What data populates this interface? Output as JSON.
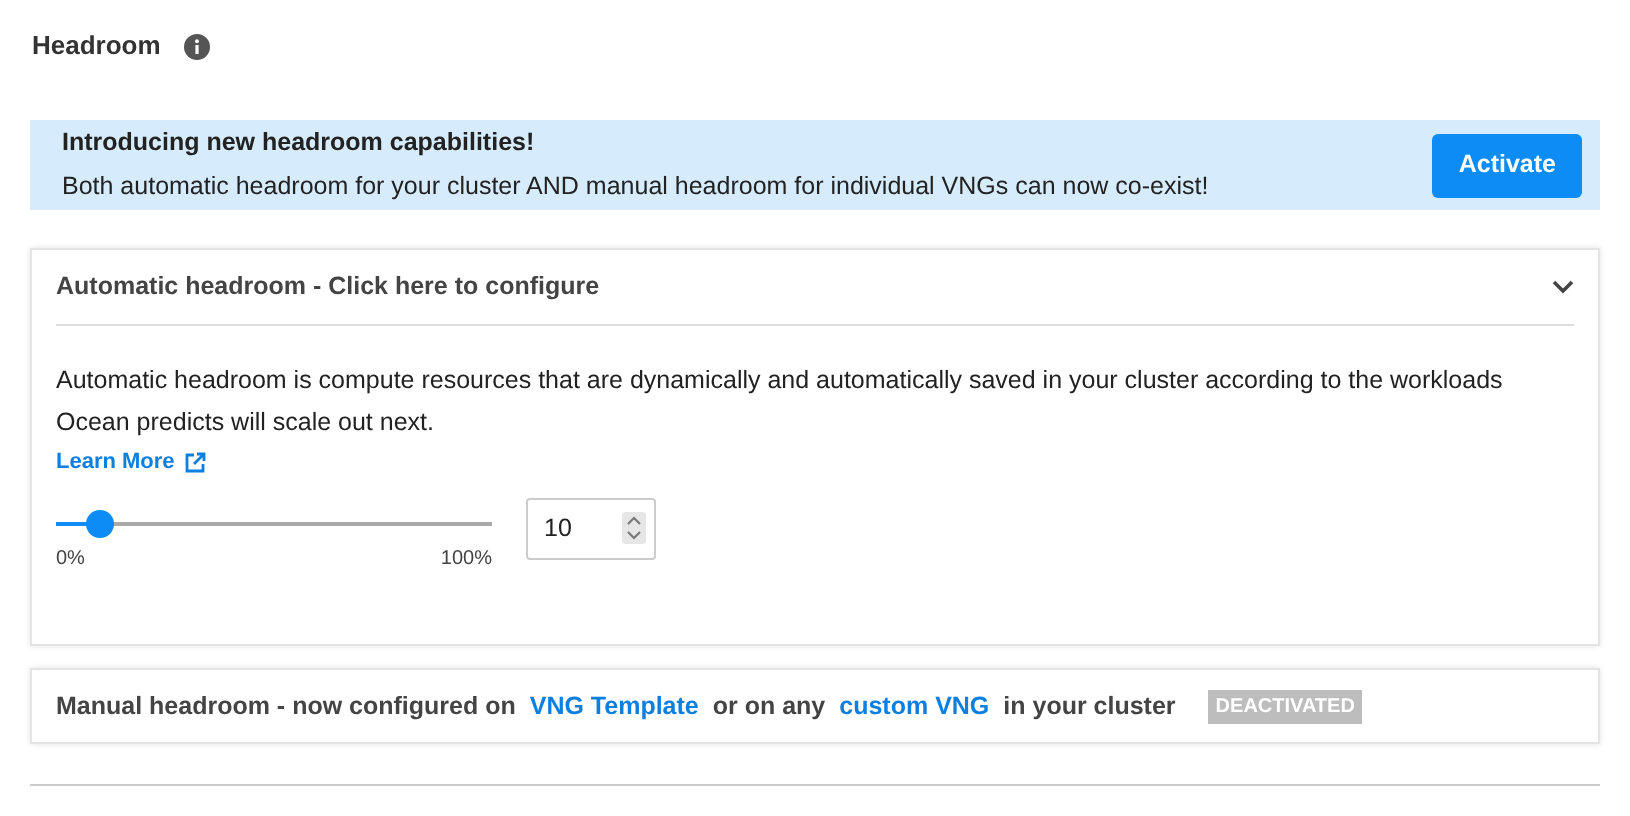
{
  "title": "Headroom",
  "banner": {
    "heading": "Introducing new headroom capabilities!",
    "text": "Both automatic headroom for your cluster AND manual headroom for individual VNGs can now co-exist!",
    "button": "Activate"
  },
  "automatic": {
    "title": "Automatic headroom - Click here to configure",
    "expanded": true,
    "description": "Automatic headroom is compute resources that are dynamically and automatically saved in your cluster according to the workloads Ocean predicts will scale out next.",
    "link": "Learn More",
    "slider": {
      "level": 0.1,
      "min_label": "0%",
      "max_label": "100%"
    },
    "value": "10"
  },
  "manual": {
    "parts": [
      {
        "kind": "text",
        "text": "Manual headroom - now configured on"
      },
      {
        "kind": "link",
        "text": "VNG Template"
      },
      {
        "kind": "text",
        "text": "or on any"
      },
      {
        "kind": "link",
        "text": "custom VNG"
      },
      {
        "kind": "text",
        "text": "in your cluster"
      }
    ],
    "badge": "DEACTIVATED"
  }
}
